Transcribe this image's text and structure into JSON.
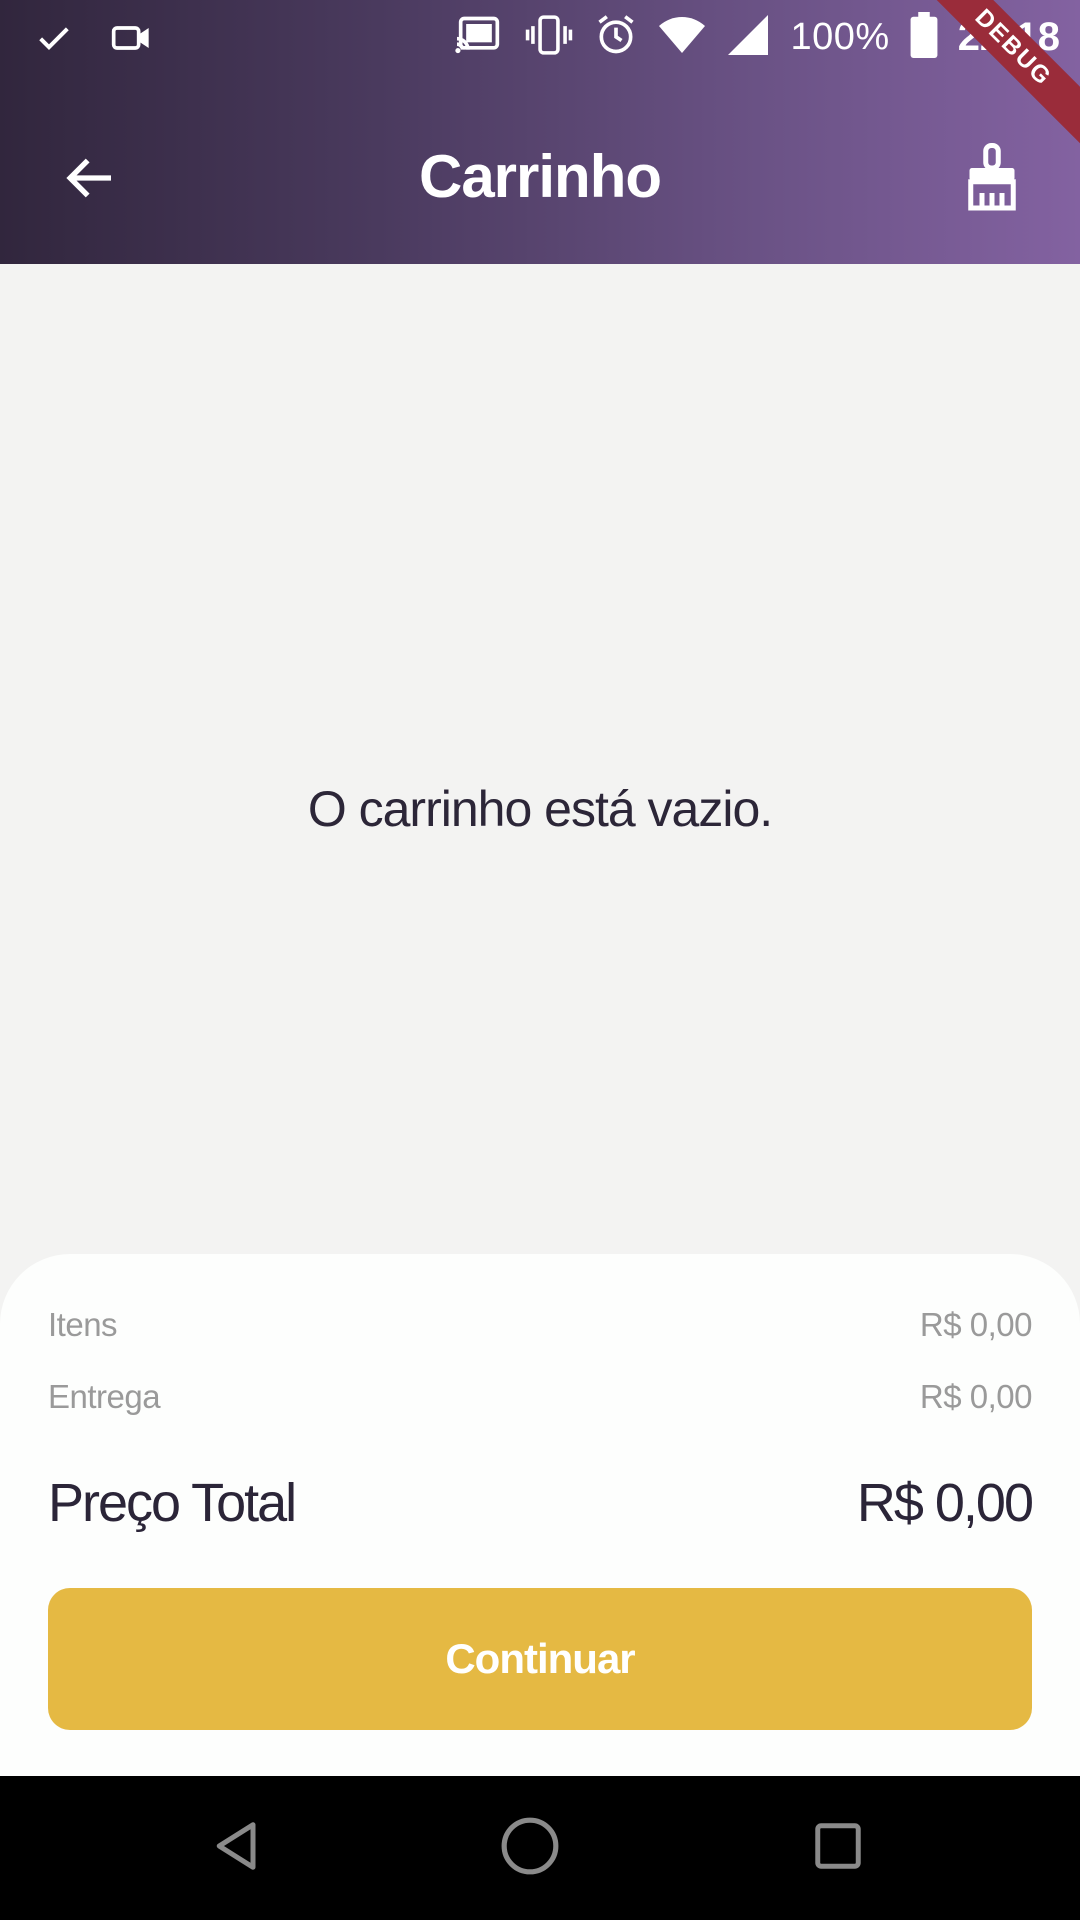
{
  "status_bar": {
    "battery": "100%",
    "time": "22:18",
    "icons": [
      "check-icon",
      "video-camera-icon",
      "cast-icon",
      "vibrate-icon",
      "alarm-icon",
      "wifi-icon",
      "signal-icon",
      "battery-icon"
    ]
  },
  "debug_banner": "DEBUG",
  "toolbar": {
    "title": "Carrinho",
    "back_icon": "arrow-back-icon",
    "clear_icon": "broom-icon"
  },
  "cart": {
    "empty_message": "O carrinho está vazio."
  },
  "summary": {
    "items_label": "Itens",
    "items_value": "R$ 0,00",
    "delivery_label": "Entrega",
    "delivery_value": "R$ 0,00",
    "total_label": "Preço Total",
    "total_value": "R$ 0,00",
    "continue_label": "Continuar"
  },
  "colors": {
    "header_start": "#31263d",
    "header_end": "#8362a1",
    "accent": "#e5b943",
    "text_dark": "#2b2538",
    "text_muted": "#9a9a9a",
    "background": "#f3f3f2"
  },
  "nav": {
    "icons": [
      "back-triangle-icon",
      "home-circle-icon",
      "recents-square-icon"
    ]
  }
}
